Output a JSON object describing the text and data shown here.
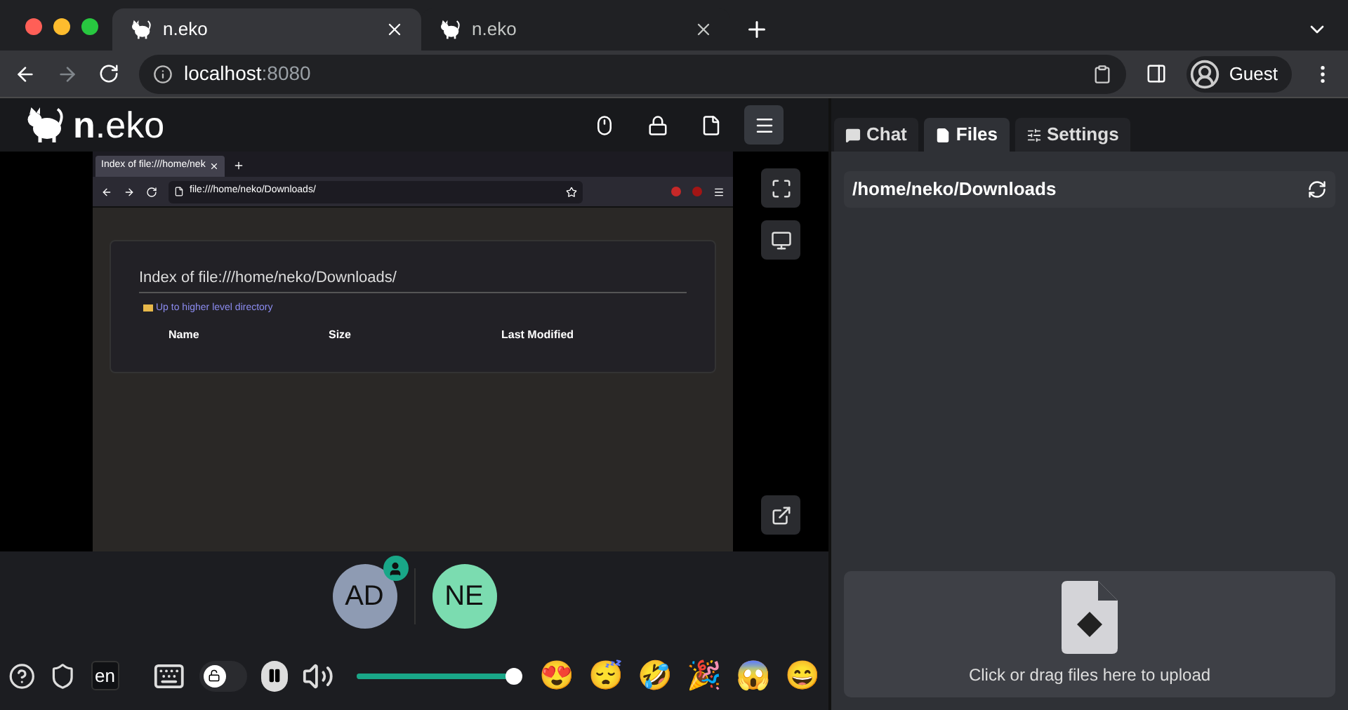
{
  "browser": {
    "tabs": [
      {
        "title": "n.eko",
        "selected": true
      },
      {
        "title": "n.eko",
        "selected": false
      }
    ],
    "address": {
      "host": "localhost",
      "port": ":8080"
    },
    "profile": "Guest"
  },
  "header": {
    "logo_bold": "n",
    "logo_rest": ".eko",
    "buttons": [
      {
        "kind": "mouse",
        "selected": false
      },
      {
        "kind": "lock",
        "selected": false
      },
      {
        "kind": "file",
        "selected": false
      },
      {
        "kind": "menu",
        "selected": true
      }
    ]
  },
  "remote_screen": {
    "tab_title": "Index of file:///home/nek",
    "url": "file:///home/neko/Downloads/",
    "heading": "Index of file:///home/neko/Downloads/",
    "parent_link": "Up to higher level directory",
    "columns": [
      "Name",
      "Size",
      "Last Modified"
    ]
  },
  "members": [
    {
      "initials": "AD",
      "color": "#8e9bb3",
      "host": true
    },
    {
      "initials": "NE",
      "color": "#7bdcb0",
      "host": false
    }
  ],
  "controls": {
    "language": "en",
    "lock_on": false,
    "volume": {
      "level": 1
    },
    "emojis": [
      "😍",
      "😴",
      "🤣",
      "🎉",
      "😱",
      "😄"
    ]
  },
  "side_tabs": [
    {
      "label": "Chat",
      "kind": "chat",
      "selected": false
    },
    {
      "label": "Files",
      "kind": "files",
      "selected": true
    },
    {
      "label": "Settings",
      "kind": "settings",
      "selected": false
    }
  ],
  "files": {
    "path": "/home/neko/Downloads",
    "upload_text": "Click or drag files here to upload"
  }
}
